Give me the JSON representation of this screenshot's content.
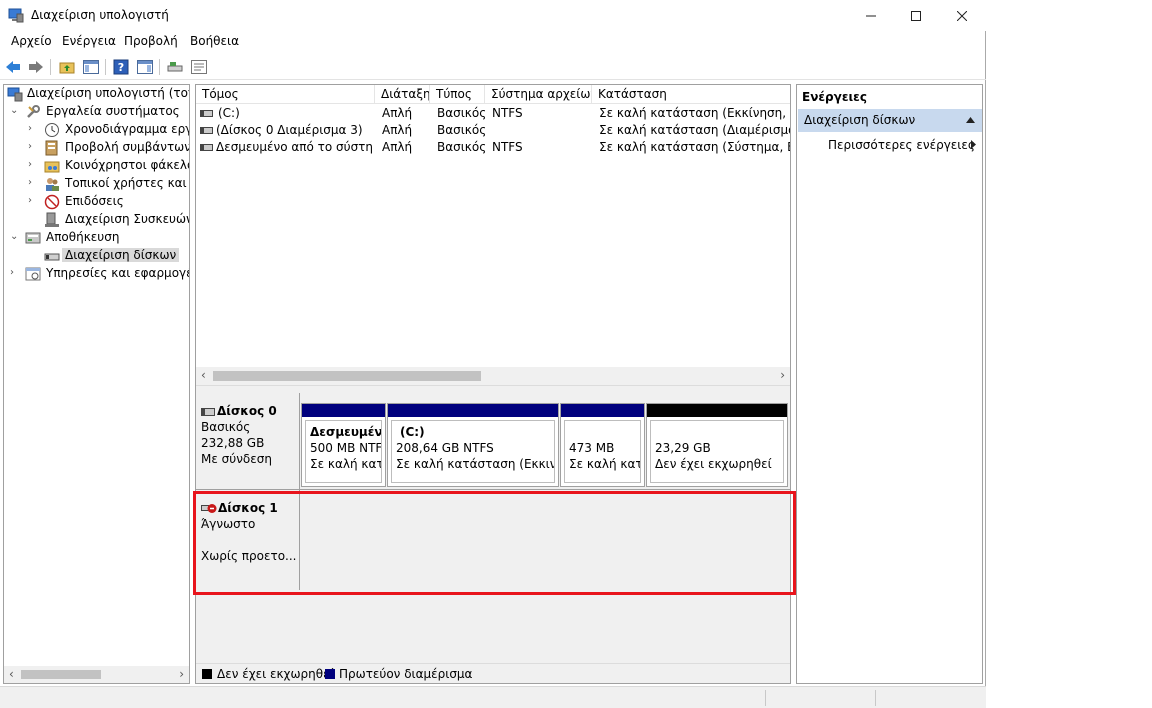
{
  "window": {
    "title": "Διαχείριση υπολογιστή",
    "menu": [
      "Αρχείο",
      "Ενέργεια",
      "Προβολή",
      "Βοήθεια"
    ]
  },
  "tree": {
    "items": [
      {
        "label": "Διαχείριση υπολογιστή (τοπικ",
        "icon": "computer-management-icon",
        "level": 0,
        "expander": ""
      },
      {
        "label": "Εργαλεία συστήματος",
        "icon": "system-tools-icon",
        "level": 1,
        "expander": "expanded"
      },
      {
        "label": "Χρονοδιάγραμμα εργας",
        "icon": "task-scheduler-icon",
        "level": 2,
        "expander": "collapsed"
      },
      {
        "label": "Προβολή συμβάντων",
        "icon": "event-viewer-icon",
        "level": 2,
        "expander": "collapsed"
      },
      {
        "label": "Κοινόχρηστοι φάκελοι",
        "icon": "shared-folders-icon",
        "level": 2,
        "expander": "collapsed"
      },
      {
        "label": "Τοπικοί χρήστες και ομ",
        "icon": "local-users-icon",
        "level": 2,
        "expander": "collapsed"
      },
      {
        "label": "Επιδόσεις",
        "icon": "performance-icon",
        "level": 2,
        "expander": "collapsed"
      },
      {
        "label": "Διαχείριση Συσκευών",
        "icon": "device-manager-icon",
        "level": 2,
        "expander": ""
      },
      {
        "label": "Αποθήκευση",
        "icon": "storage-icon",
        "level": 1,
        "expander": "expanded"
      },
      {
        "label": "Διαχείριση δίσκων",
        "icon": "disk-management-icon",
        "level": 2,
        "expander": "",
        "selected": true
      },
      {
        "label": "Υπηρεσίες και εφαρμογές",
        "icon": "services-apps-icon",
        "level": 1,
        "expander": "collapsed"
      }
    ]
  },
  "volumes": {
    "columns": [
      "Τόμος",
      "Διάταξη",
      "Τύπος",
      "Σύστημα αρχείων",
      "Κατάσταση"
    ],
    "rows": [
      [
        "(C:)",
        "Απλή",
        "Βασικός",
        "NTFS",
        "Σε καλή κατάσταση (Εκκίνηση, Αρχε"
      ],
      [
        "(Δίσκος 0 Διαμέρισμα 3)",
        "Απλή",
        "Βασικός",
        "",
        "Σε καλή κατάσταση (Διαμέρισμα απ"
      ],
      [
        "Δεσμευμένο από το σύστημα",
        "Απλή",
        "Βασικός",
        "NTFS",
        "Σε καλή κατάσταση (Σύστημα, Ενερ"
      ]
    ]
  },
  "disks": {
    "disk0": {
      "name": "Δίσκος 0",
      "type": "Βασικός",
      "size": "232,88 GB",
      "status": "Με σύνδεση",
      "partitions": [
        {
          "title": "Δεσμευμένο",
          "size": "500 MB NTFS",
          "status": "Σε καλή κατάσ",
          "bar": "primary"
        },
        {
          "title": "(C:)",
          "size": "208,64 GB NTFS",
          "status": "Σε καλή κατάσταση (Εκκινηση",
          "bar": "primary"
        },
        {
          "title": "",
          "size": "473 MB",
          "status": "Σε καλή κατά",
          "bar": "primary"
        },
        {
          "title": "",
          "size": "23,29 GB",
          "status": "Δεν έχει εκχωρηθεί",
          "bar": "unallocated"
        }
      ]
    },
    "disk1": {
      "name": "Δίσκος 1",
      "type": "Άγνωστο",
      "status": "Χωρίς προετο..."
    }
  },
  "legend": {
    "unallocated": "Δεν έχει εκχωρηθεί",
    "primary": "Πρωτεύον διαμέρισμα"
  },
  "actions": {
    "title": "Ενέργειες",
    "section": "Διαχείριση δίσκων",
    "more": "Περισσότερες ενέργειες"
  },
  "colors": {
    "primary_partition": "#00007d",
    "unallocated": "#000000",
    "highlight": "#e8141c",
    "action_section": "#c8d9ee"
  }
}
